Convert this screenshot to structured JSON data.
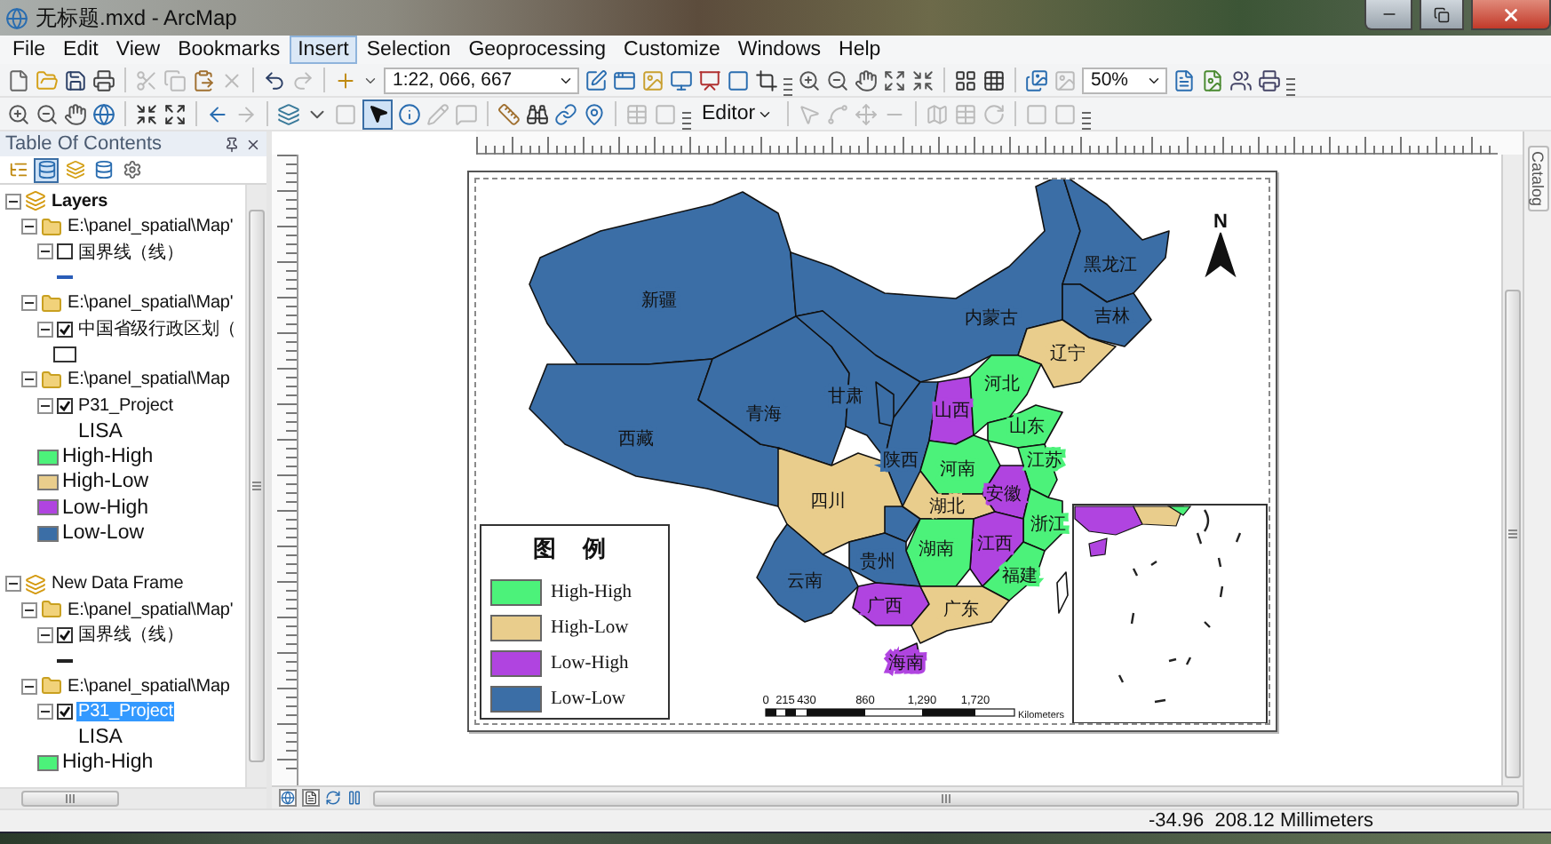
{
  "window": {
    "title": "无标题.mxd - ArcMap"
  },
  "menu": [
    {
      "label": "File",
      "selected": false
    },
    {
      "label": "Edit",
      "selected": false
    },
    {
      "label": "View",
      "selected": false
    },
    {
      "label": "Bookmarks",
      "selected": false
    },
    {
      "label": "Insert",
      "selected": true
    },
    {
      "label": "Selection",
      "selected": false
    },
    {
      "label": "Geoprocessing",
      "selected": false
    },
    {
      "label": "Customize",
      "selected": false
    },
    {
      "label": "Windows",
      "selected": false
    },
    {
      "label": "Help",
      "selected": false
    }
  ],
  "toolbar": {
    "scale": "1:22, 066, 667",
    "zoom": "50%",
    "editor": "Editor",
    "pointer_selected": true
  },
  "toc": {
    "title": "Table Of Contents",
    "views": [
      {
        "selected": false
      },
      {
        "selected": true
      },
      {
        "selected": false
      },
      {
        "selected": false
      },
      {
        "selected": false
      }
    ],
    "tree": [
      {
        "kind": "frame",
        "label": "Layers",
        "expanded": true,
        "children": [
          {
            "kind": "group",
            "label": "E:\\panel_spatial\\Map'",
            "expanded": true,
            "children": [
              {
                "kind": "layer",
                "label": "国界线（线）",
                "expanded": true,
                "checked": false,
                "selected": false,
                "children": [
                  {
                    "kind": "line",
                    "color": "#2a5db8"
                  }
                ]
              }
            ]
          },
          {
            "kind": "group",
            "label": "E:\\panel_spatial\\Map'",
            "expanded": true,
            "children": [
              {
                "kind": "layer",
                "label": "中国省级行政区划（",
                "expanded": true,
                "checked": true,
                "selected": false,
                "children": [
                  {
                    "kind": "fill"
                  }
                ]
              }
            ]
          },
          {
            "kind": "group",
            "label": "E:\\panel_spatial\\Map",
            "expanded": true,
            "children": [
              {
                "kind": "layer",
                "label": "P31_Project",
                "expanded": true,
                "checked": true,
                "selected": false,
                "children": [
                  {
                    "kind": "heading",
                    "label": "LISA"
                  },
                  {
                    "kind": "class",
                    "label": "High-High",
                    "color": "#4cf27a"
                  },
                  {
                    "kind": "class",
                    "label": "High-Low",
                    "color": "#e9cd8c"
                  },
                  {
                    "kind": "class",
                    "label": "Low-High",
                    "color": "#b044e0"
                  },
                  {
                    "kind": "class",
                    "label": "Low-Low",
                    "color": "#3b6ea6"
                  }
                ]
              }
            ]
          }
        ]
      },
      {
        "kind": "frame",
        "label": "New Data Frame",
        "expanded": true,
        "children": [
          {
            "kind": "group",
            "label": "E:\\panel_spatial\\Map'",
            "expanded": true,
            "children": [
              {
                "kind": "layer",
                "label": "国界线（线）",
                "expanded": true,
                "checked": true,
                "selected": false,
                "children": [
                  {
                    "kind": "line",
                    "color": "#222222"
                  }
                ]
              }
            ]
          },
          {
            "kind": "group",
            "label": "E:\\panel_spatial\\Map",
            "expanded": true,
            "children": [
              {
                "kind": "layer",
                "label": "P31_Project",
                "expanded": true,
                "checked": true,
                "selected": true,
                "children": [
                  {
                    "kind": "heading",
                    "label": "LISA"
                  },
                  {
                    "kind": "class",
                    "label": "High-High",
                    "color": "#4cf27a"
                  }
                ]
              }
            ]
          }
        ]
      }
    ]
  },
  "map": {
    "legend": {
      "title": "图 例",
      "items": [
        {
          "label": "High-High",
          "color": "#4cf27a"
        },
        {
          "label": "High-Low",
          "color": "#e9cd8c"
        },
        {
          "label": "Low-High",
          "color": "#b044e0"
        },
        {
          "label": "Low-Low",
          "color": "#3b6ea6"
        }
      ]
    },
    "north": "N",
    "scale_labels": [
      "0",
      "215",
      "430",
      "860",
      "1,290",
      "1,720"
    ],
    "scale_unit": "Kilometers",
    "regions": [
      {
        "name": "新疆",
        "color": "#3b6ea6"
      },
      {
        "name": "西藏",
        "color": "#3b6ea6"
      },
      {
        "name": "青海",
        "color": "#3b6ea6"
      },
      {
        "name": "内蒙古",
        "color": "#3b6ea6"
      },
      {
        "name": "黑龙江",
        "color": "#3b6ea6"
      },
      {
        "name": "吉林",
        "color": "#3b6ea6"
      },
      {
        "name": "辽宁",
        "color": "#e9cd8c"
      },
      {
        "name": "甘肃",
        "color": "#3b6ea6"
      },
      {
        "color": "#3b6ea6"
      },
      {
        "name": "陕西",
        "color": "#3b6ea6"
      },
      {
        "name": "山西",
        "color": "#b044e0"
      },
      {
        "name": "河北",
        "color": "#4cf27a"
      },
      {
        "name": "山东",
        "color": "#4cf27a"
      },
      {
        "name": "河南",
        "color": "#4cf27a"
      },
      {
        "name": "江苏",
        "color": "#4cf27a"
      },
      {
        "name": "安徽",
        "color": "#b044e0"
      },
      {
        "name": "四川",
        "color": "#e9cd8c"
      },
      {
        "color": "#3b6ea6"
      },
      {
        "name": "湖北",
        "color": "#e9cd8c"
      },
      {
        "name": "浙江",
        "color": "#4cf27a"
      },
      {
        "name": "江西",
        "color": "#b044e0"
      },
      {
        "name": "福建",
        "color": "#4cf27a"
      },
      {
        "name": "湖南",
        "color": "#4cf27a"
      },
      {
        "name": "贵州",
        "color": "#3b6ea6"
      },
      {
        "name": "云南",
        "color": "#3b6ea6"
      },
      {
        "name": "广西",
        "color": "#b044e0"
      },
      {
        "name": "广东",
        "color": "#e9cd8c"
      },
      {
        "name": "海南",
        "color": "#b044e0"
      },
      {
        "color": "#ffffff"
      }
    ]
  },
  "catalog_tab": "Catalog",
  "status_bar": {
    "coordinates": "-34.96  208.12 Millimeters"
  }
}
